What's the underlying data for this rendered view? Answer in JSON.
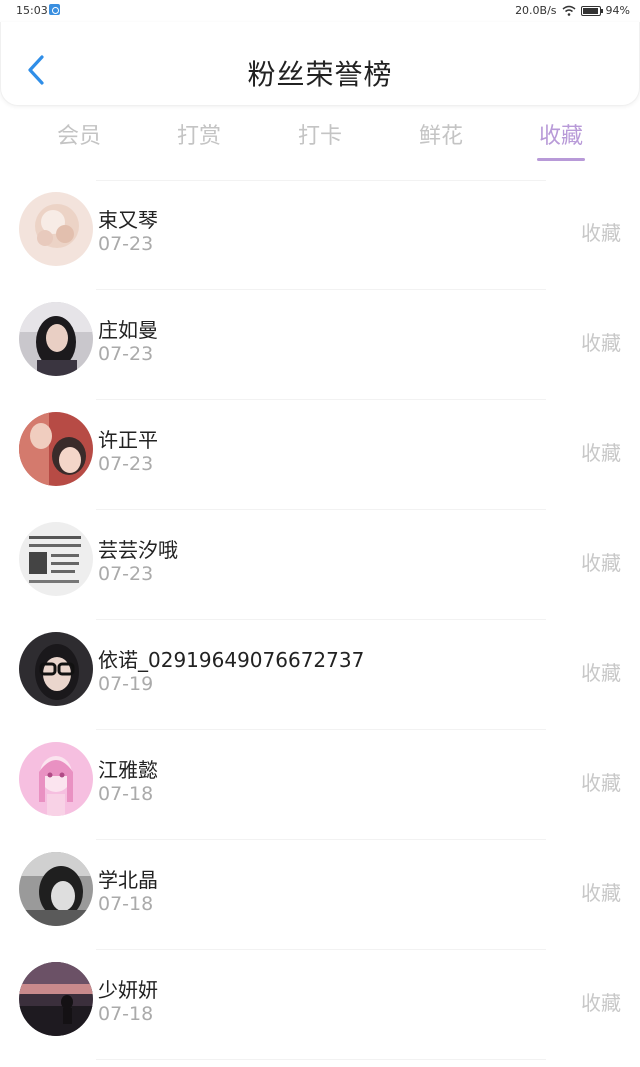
{
  "status_bar": {
    "time": "15:03",
    "network_speed": "20.0B/s",
    "battery": "94%"
  },
  "header": {
    "title": "粉丝荣誉榜",
    "back_icon": "chevron-left-icon",
    "accent_color": "#2f8ee8"
  },
  "tabs": [
    {
      "label": "会员",
      "active": false
    },
    {
      "label": "打赏",
      "active": false
    },
    {
      "label": "打卡",
      "active": false
    },
    {
      "label": "鲜花",
      "active": false
    },
    {
      "label": "收藏",
      "active": true
    }
  ],
  "active_tab_color": "#b89ad8",
  "fans": [
    {
      "name": "束又琴",
      "date": "07-23",
      "action": "收藏",
      "avatar": "photo-avatar-flower"
    },
    {
      "name": "庄如曼",
      "date": "07-23",
      "action": "收藏",
      "avatar": "photo-avatar-woman"
    },
    {
      "name": "许正平",
      "date": "07-23",
      "action": "收藏",
      "avatar": "photo-avatar-selfie"
    },
    {
      "name": "芸芸汐哦",
      "date": "07-23",
      "action": "收藏",
      "avatar": "photo-avatar-document"
    },
    {
      "name": "依诺_02919649076672737",
      "date": "07-19",
      "action": "收藏",
      "avatar": "photo-avatar-glasses"
    },
    {
      "name": "江雅懿",
      "date": "07-18",
      "action": "收藏",
      "avatar": "illustration-avatar-pink"
    },
    {
      "name": "学北晶",
      "date": "07-18",
      "action": "收藏",
      "avatar": "photo-avatar-bw"
    },
    {
      "name": "少妍妍",
      "date": "07-18",
      "action": "收藏",
      "avatar": "photo-avatar-sunset"
    }
  ]
}
